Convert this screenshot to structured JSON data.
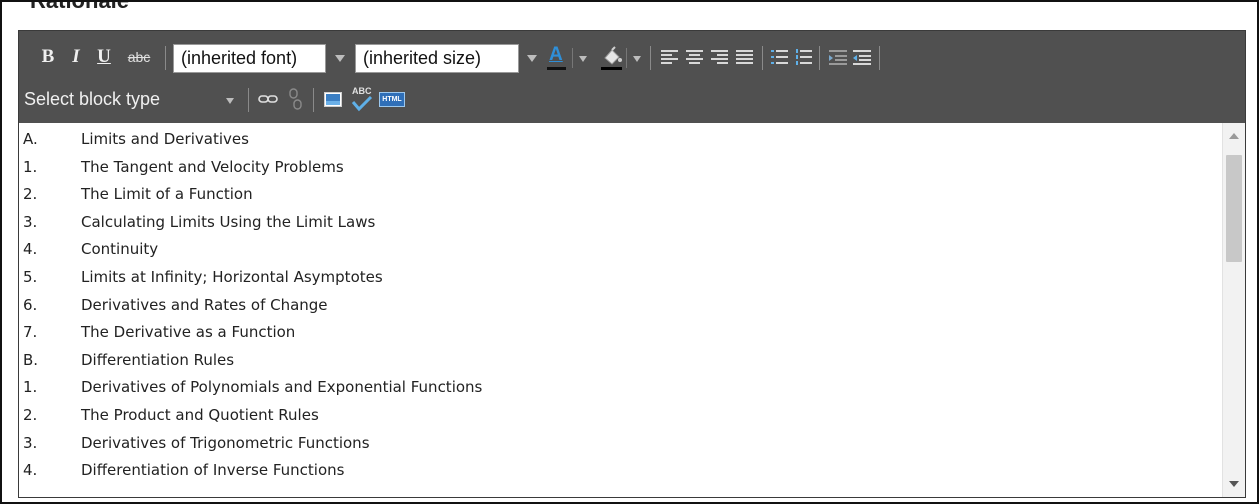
{
  "section": {
    "heading": "Rationale"
  },
  "toolbar": {
    "bold_label": "B",
    "italic_label": "I",
    "underline_label": "U",
    "strike_label": "abc",
    "font_select": "(inherited font)",
    "size_select": "(inherited size)",
    "font_color_label": "A",
    "block_type_select": "Select block type",
    "spellcheck_label": "ABC",
    "html_label": "HTML",
    "colors": {
      "toolbar_bg": "#505050",
      "font_color_accent": "#2f8fd8",
      "highlight_underline": "#000000"
    }
  },
  "content": {
    "lines": [
      {
        "num": "A.",
        "text": "Limits and Derivatives"
      },
      {
        "num": "1.",
        "text": "The Tangent and Velocity Problems"
      },
      {
        "num": "2.",
        "text": "The Limit of a Function"
      },
      {
        "num": "3.",
        "text": "Calculating Limits Using the Limit Laws"
      },
      {
        "num": "4.",
        "text": "Continuity"
      },
      {
        "num": "5.",
        "text": "Limits at Infinity; Horizontal Asymptotes"
      },
      {
        "num": "6.",
        "text": "Derivatives and Rates of Change"
      },
      {
        "num": "7.",
        "text": "The Derivative as a Function"
      },
      {
        "num": "B.",
        "text": "Differentiation Rules"
      },
      {
        "num": "1.",
        "text": "Derivatives of Polynomials and Exponential Functions"
      },
      {
        "num": "2.",
        "text": "The Product and Quotient Rules"
      },
      {
        "num": "3.",
        "text": "Derivatives of Trigonometric Functions"
      },
      {
        "num": "4.",
        "text": "Differentiation of Inverse Functions"
      }
    ]
  }
}
